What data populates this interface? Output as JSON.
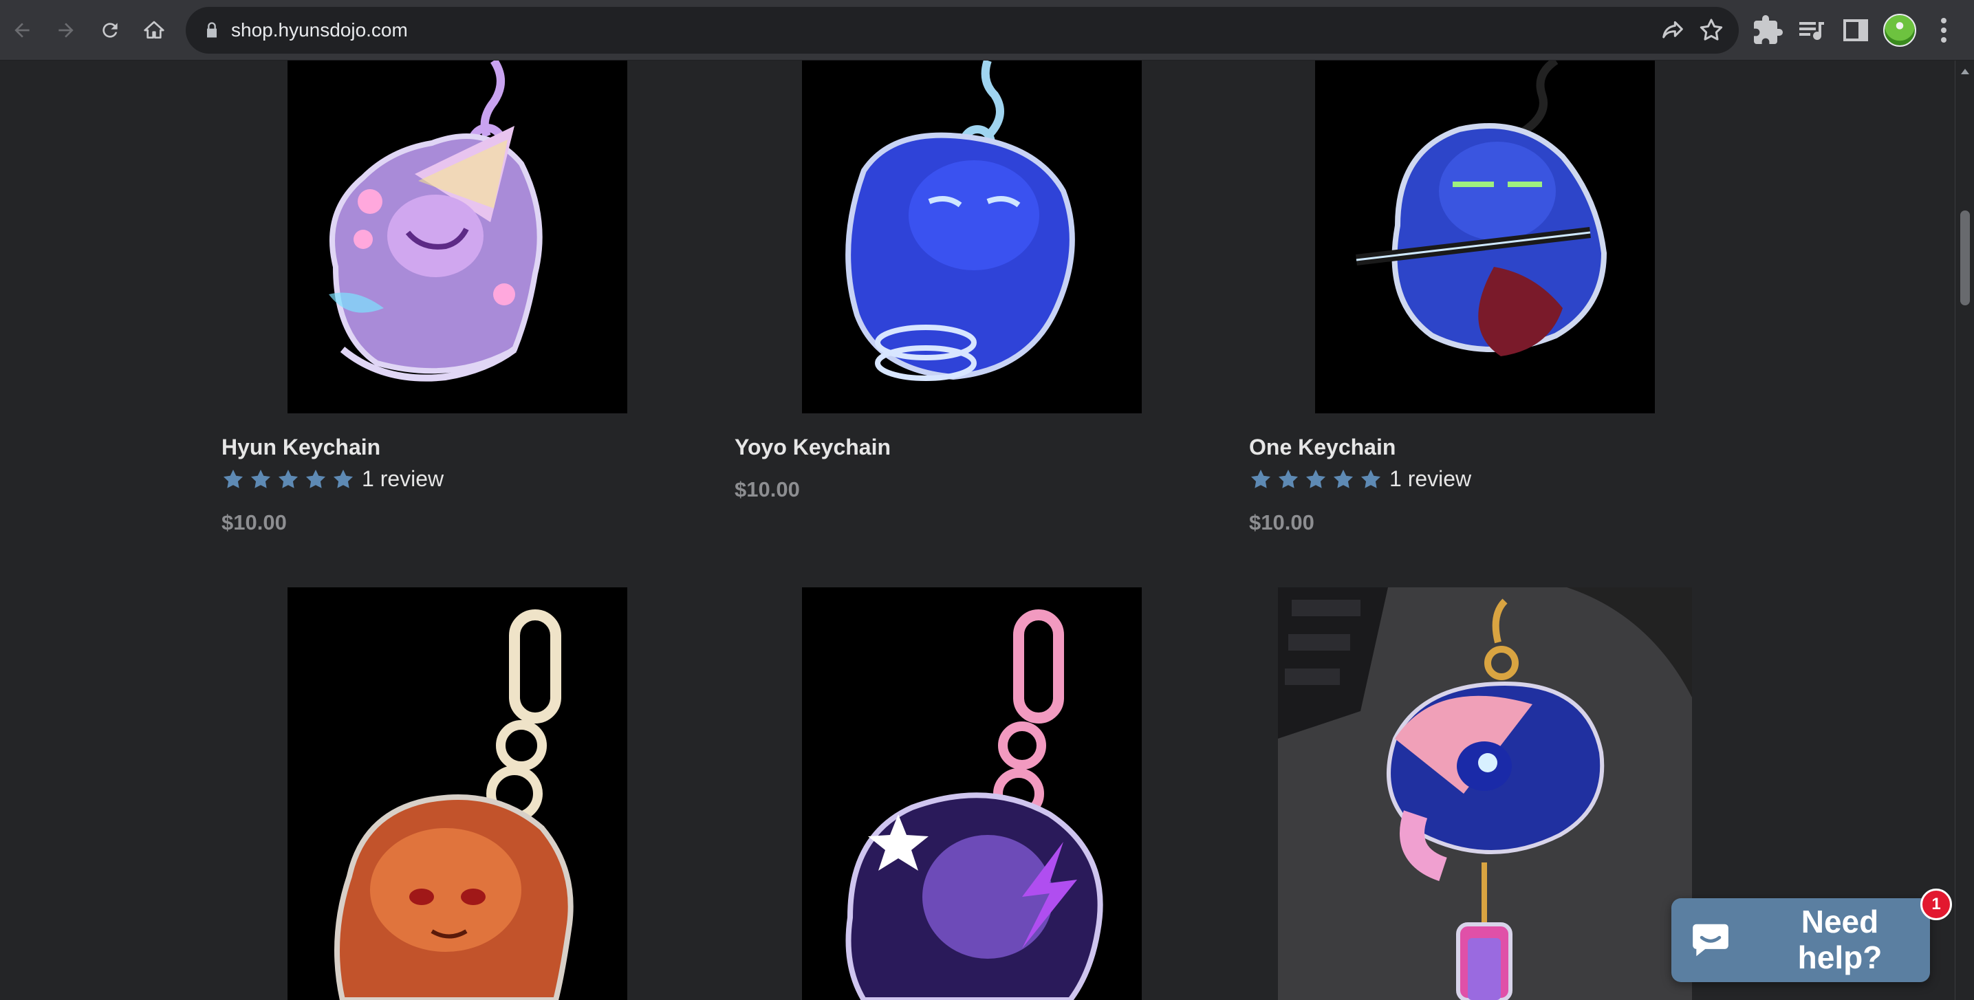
{
  "browser": {
    "url": "shop.hyunsdojo.com"
  },
  "products": [
    {
      "title": "Hyun Keychain",
      "stars": 5,
      "review_text": "1 review",
      "price": "$10.00"
    },
    {
      "title": "Yoyo Keychain",
      "price": "$10.00"
    },
    {
      "title": "One Keychain",
      "stars": 5,
      "review_text": "1 review",
      "price": "$10.00"
    }
  ],
  "chat": {
    "label": "Need help?",
    "badge": "1"
  },
  "colors": {
    "background": "#242527",
    "star": "#5e8ab4",
    "chat": "#5b7fa1",
    "badge": "#e2182f"
  }
}
